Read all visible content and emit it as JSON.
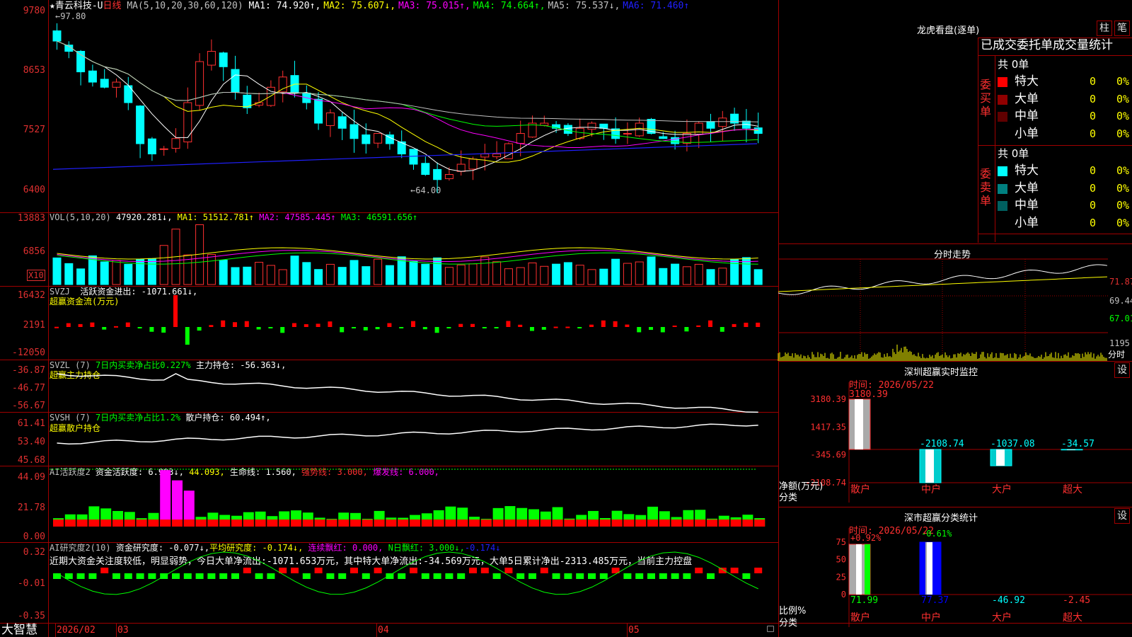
{
  "colors": {
    "red": "#ff3030",
    "cyan": "#00ffff",
    "green": "#00ff00",
    "yellow": "#ffff00",
    "magenta": "#ff00ff",
    "white": "#ffffff",
    "blue": "#2020ff",
    "axis": "#e03030",
    "grid": "#a00000"
  },
  "main": {
    "title": "青云科技-U",
    "period": "日线",
    "ma_label": "MA(5,10,20,30,60,120)",
    "ma": [
      {
        "label": "MA1: 74.920↑",
        "color": "#ffffff"
      },
      {
        "label": "MA2: 75.607↓",
        "color": "#ffff00"
      },
      {
        "label": "MA3: 75.015↑",
        "color": "#ff00ff"
      },
      {
        "label": "MA4: 74.664↑",
        "color": "#00ff00"
      },
      {
        "label": "MA5: 75.537↓",
        "color": "#c0c0c0"
      },
      {
        "label": "MA6: 71.460↑",
        "color": "#2020ff"
      }
    ],
    "high_mark": "97.80",
    "low_mark": "64.00",
    "yticks": [
      "9780",
      "8653",
      "7527",
      "6400"
    ]
  },
  "vol": {
    "label": "VOL(5,10,20)",
    "value": "47920.281↓",
    "ma1": "MA1: 51512.781↑",
    "ma2": "MA2: 47585.445↑",
    "ma3": "MA3: 46591.656↑",
    "yticks": [
      "13883",
      "6856"
    ],
    "unit": "X10"
  },
  "svzj": {
    "label": "SVZJ",
    "desc": "活跃资金进出: -1071.661↓,",
    "subtitle": "超赢资金流(万元)",
    "yticks": [
      "16432",
      "2191",
      "-12050"
    ]
  },
  "svzl": {
    "label": "SVZL (7)",
    "desc1": "7日内买卖净占比0.227%",
    "desc2": "主力持仓: -56.363↓,",
    "subtitle": "超赢主力持仓",
    "yticks": [
      "-36.87",
      "-46.77",
      "-56.67"
    ]
  },
  "svsh": {
    "label": "SVSH (7)",
    "desc1": "7日内买卖净占比1.2%",
    "desc2": "散户持仓: 60.494↑,",
    "subtitle": "超赢散户持仓",
    "yticks": [
      "61.41",
      "53.40",
      "45.68"
    ]
  },
  "ai1": {
    "label": "AI活跃度2",
    "desc": "资金活跃度: 6.903↓,",
    "v2": "44.093,",
    "v3": "生命线: 1.560,",
    "v4": "强势线: 3.000,",
    "v5": "爆发线: 6.000,",
    "yticks": [
      "44.09",
      "21.78",
      "0.00"
    ]
  },
  "ai2": {
    "label": "AI研究度2(10)",
    "desc": "资金研究度: -0.077↓,",
    "v2": "平均研究度: -0.174↓,",
    "v3": "连续飘红: 0.000,",
    "v4": "N日飘红: 3.000↓,",
    "v5": "-0.174↓",
    "summary": "近期大资金关注度较低，明显弱势，今日大单净流出:-1071.653万元，其中特大单净流出:-34.569万元，大单5日累计净出-2313.485万元，当前主力控盘",
    "yticks": [
      "0.32",
      "-0.01",
      "-0.35"
    ]
  },
  "bottom": {
    "brand": "大智慧",
    "labels": [
      "2026/02",
      "03",
      "04",
      "05"
    ]
  },
  "right": {
    "title": "龙虎看盘(逐单)",
    "btn1": "柱",
    "btn2": "笔",
    "stats_title": "已成交委托单成交量统计",
    "buy": {
      "head": "共 0单",
      "side": "委买单",
      "rows": [
        {
          "name": "特大",
          "count": "0",
          "pct": "0%",
          "color": "#ff0000"
        },
        {
          "name": "大单",
          "count": "0",
          "pct": "0%",
          "color": "#900000"
        },
        {
          "name": "中单",
          "count": "0",
          "pct": "0%",
          "color": "#600000"
        },
        {
          "name": "小单",
          "count": "0",
          "pct": "0%",
          "color": "#000000"
        }
      ]
    },
    "sell": {
      "head": "共 0单",
      "side": "委卖单",
      "rows": [
        {
          "name": "特大",
          "count": "0",
          "pct": "0%",
          "color": "#00ffff"
        },
        {
          "name": "大单",
          "count": "0",
          "pct": "0%",
          "color": "#008080"
        },
        {
          "name": "中单",
          "count": "0",
          "pct": "0%",
          "color": "#006060"
        },
        {
          "name": "小单",
          "count": "0",
          "pct": "0%",
          "color": "#000000"
        }
      ]
    },
    "intraday": {
      "title": "分时走势",
      "yticks": [
        "71.87",
        "69.44",
        "67.01"
      ],
      "vol_tick": "1195",
      "vol_label": "分时"
    },
    "monitor": {
      "title": "深圳超赢实时监控",
      "btn": "设",
      "time": "时间: 2026/05/22",
      "yticks": [
        "3180.39",
        "1417.35",
        "-345.69",
        "-2108.74"
      ],
      "ylabel": "净额(万元)",
      "xlabel": "分类",
      "cats": [
        "散户",
        "中户",
        "大户",
        "超大"
      ],
      "values": [
        3180.39,
        -2108.74,
        -1037.08,
        -34.57
      ],
      "value_labels": [
        "3180.39",
        "-2108.74",
        "-1037.08",
        "-34.57"
      ]
    },
    "classify": {
      "title": "深市超赢分类统计",
      "btn": "设",
      "time": "时间: 2026/05/22",
      "yticks": [
        "75",
        "50",
        "25",
        "0"
      ],
      "ylabel": "比例%",
      "xlabel": "分类",
      "cats": [
        "散户",
        "中户",
        "大户",
        "超大"
      ],
      "top_labels": [
        "+0.92%",
        "-0.61%",
        "",
        ""
      ],
      "bottom_labels": [
        "71.99",
        "77.37",
        "-46.92",
        "-2.45"
      ],
      "values": [
        71.99,
        77.37,
        -46.92,
        -2.45
      ]
    }
  }
}
